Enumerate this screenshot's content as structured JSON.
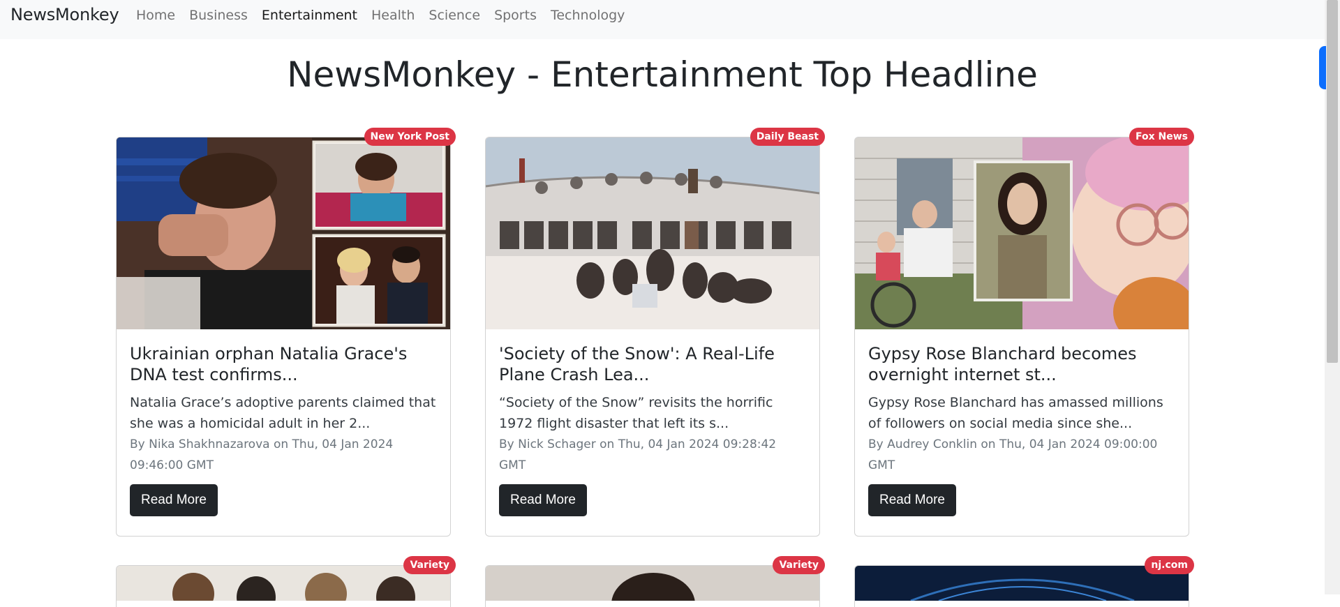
{
  "nav": {
    "brand": "NewsMonkey",
    "links": [
      "Home",
      "Business",
      "Entertainment",
      "Health",
      "Science",
      "Sports",
      "Technology"
    ],
    "active": "Entertainment"
  },
  "page": {
    "title": "NewsMonkey - Entertainment Top Headline"
  },
  "cards": [
    {
      "source": "New York Post",
      "title": "Ukrainian orphan Natalia Grace's DNA test confirms...",
      "description": "Natalia Grace’s adoptive parents claimed that she was a homicidal adult in her 2...",
      "meta": "By Nika Shakhnazarova on Thu, 04 Jan 2024 09:46:00 GMT",
      "button": "Read More"
    },
    {
      "source": "Daily Beast",
      "title": "'Society of the Snow': A Real-Life Plane Crash Lea...",
      "description": "“Society of the Snow” revisits the horrific 1972 flight disaster that left its s...",
      "meta": "By Nick Schager on Thu, 04 Jan 2024 09:28:42 GMT",
      "button": "Read More"
    },
    {
      "source": "Fox News",
      "title": "Gypsy Rose Blanchard becomes overnight internet st...",
      "description": "Gypsy Rose Blanchard has amassed millions of followers on social media since she...",
      "meta": "By Audrey Conklin on Thu, 04 Jan 2024 09:00:00 GMT",
      "button": "Read More"
    }
  ],
  "partial_cards": [
    {
      "source": "Variety"
    },
    {
      "source": "Variety"
    },
    {
      "source": "nj.com"
    }
  ],
  "colors": {
    "badge": "#dc3545",
    "button": "#212529",
    "accent": "#0d6efd"
  }
}
